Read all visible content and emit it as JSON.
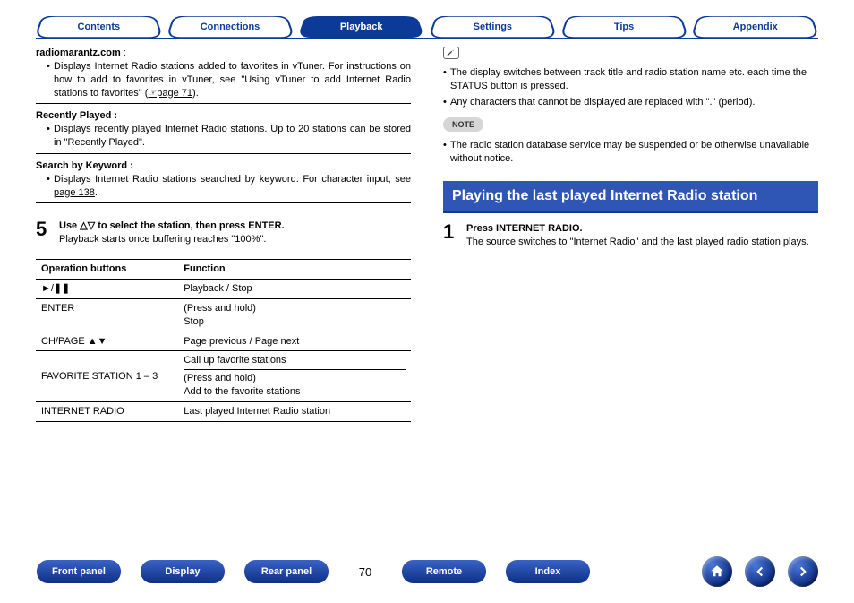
{
  "tabs": [
    "Contents",
    "Connections",
    "Playback",
    "Settings",
    "Tips",
    "Appendix"
  ],
  "active_tab_index": 2,
  "left": {
    "radiomarantz_label": "radiomarantz.com",
    "radiomarantz_colon": " : ",
    "radiomarantz_body_a": "Displays Internet Radio stations added to favorites in vTuner. For instructions on how to add to favorites in vTuner, see \"Using vTuner to add Internet Radio stations to favorites\" (",
    "radiomarantz_body_link": "☞page 71",
    "radiomarantz_body_b": ").",
    "recently_label": "Recently Played :",
    "recently_body": "Displays recently played Internet Radio stations. Up to 20 stations can be stored in \"Recently Played\".",
    "search_label": "Search by Keyword :",
    "search_body_a": "Displays Internet Radio stations searched by keyword. For character input, see ",
    "search_body_link": "page 138",
    "search_body_b": ".",
    "step5_num": "5",
    "step5_head": "Use △▽ to select the station, then press ENTER.",
    "step5_desc": "Playback starts once buffering reaches \"100%\".",
    "table": {
      "h1": "Operation buttons",
      "h2": "Function",
      "rows": [
        {
          "op": "►/❚❚",
          "fn": "Playback / Stop"
        },
        {
          "op": "ENTER",
          "fn_a": "(Press and hold)",
          "fn_b": "Stop"
        },
        {
          "op": "CH/PAGE ▲▼",
          "fn": "Page previous / Page next"
        },
        {
          "op": "FAVORITE STATION 1 – 3",
          "fn_a": "Call up favorite stations",
          "fn_b": "(Press and hold)",
          "fn_c": "Add to the favorite stations"
        },
        {
          "op": "INTERNET RADIO",
          "fn": "Last played Internet Radio station"
        }
      ]
    }
  },
  "right": {
    "tip1": "The display switches between track title and radio station name etc. each time the STATUS button is pressed.",
    "tip2": "Any characters that cannot be displayed are replaced with \".\" (period).",
    "note_label": "NOTE",
    "note1": "The radio station database service may be suspended or be otherwise unavailable without notice.",
    "section_title": "Playing the last played Internet Radio station",
    "step1_num": "1",
    "step1_head": "Press INTERNET RADIO.",
    "step1_desc": "The source switches to \"Internet Radio\" and the last played radio station plays."
  },
  "footer": {
    "buttons": [
      "Front panel",
      "Display",
      "Rear panel"
    ],
    "page_number": "70",
    "buttons2": [
      "Remote",
      "Index"
    ]
  }
}
